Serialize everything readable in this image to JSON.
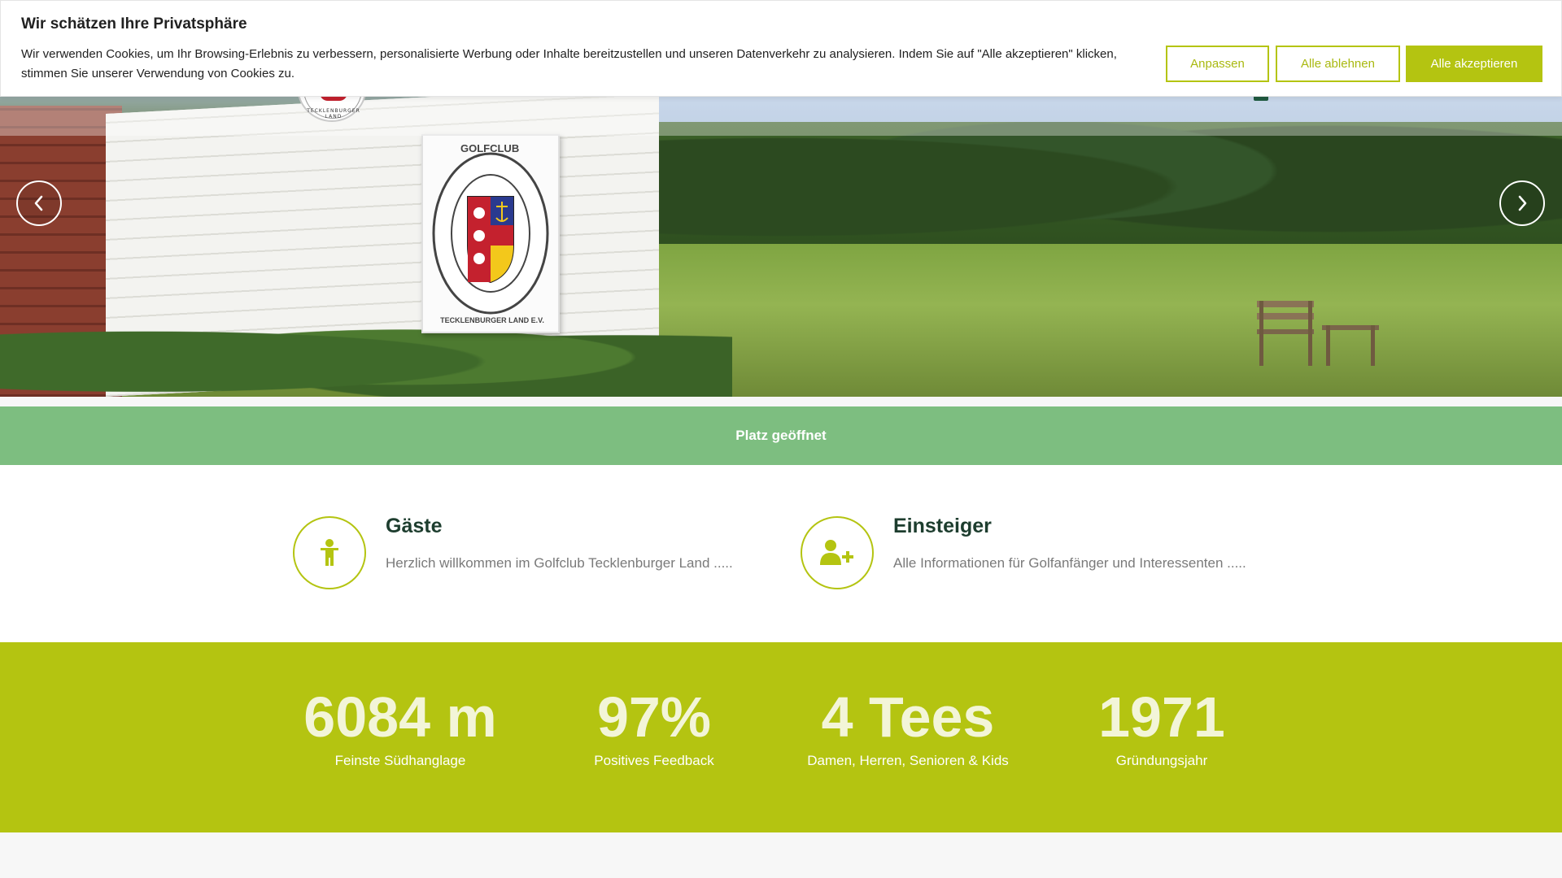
{
  "cookie_banner": {
    "title": "Wir schätzen Ihre Privatsphäre",
    "text": "Wir verwenden Cookies, um Ihr Browsing-Erlebnis zu verbessern, personalisierte Werbung oder Inhalte bereitzustellen und unseren Datenverkehr zu analysieren. Indem Sie auf \"Alle akzeptieren\" klicken, stimmen Sie unserer Verwendung von Cookies zu.",
    "customize_label": "Anpassen",
    "reject_label": "Alle ablehnen",
    "accept_label": "Alle akzeptieren"
  },
  "hero": {
    "plaque_top": "GOLFCLUB",
    "plaque_bottom": "TECKLENBURGER LAND E.V.",
    "logo_text": "TECKLENBURGER LAND"
  },
  "status": {
    "label": "Platz geöffnet",
    "color": "#7dbe80"
  },
  "features": [
    {
      "title": "Gäste",
      "text": "Herzlich willkommen im Golfclub Tecklenburger Land .....",
      "icon": "person-icon"
    },
    {
      "title": "Einsteiger",
      "text": "Alle Informationen für Golfanfänger und Interessenten .....",
      "icon": "user-plus-icon"
    }
  ],
  "stats": [
    {
      "value": "6084 m",
      "label": "Feinste Südhanglage"
    },
    {
      "value": "97%",
      "label": "Positives Feedback"
    },
    {
      "value": "4 Tees",
      "label": "Damen, Herren, Senioren & Kids"
    },
    {
      "value": "1971",
      "label": "Gründungsjahr"
    }
  ],
  "colors": {
    "accent": "#b4c411",
    "heading": "#1d3d2e",
    "status_green": "#7dbe80"
  }
}
